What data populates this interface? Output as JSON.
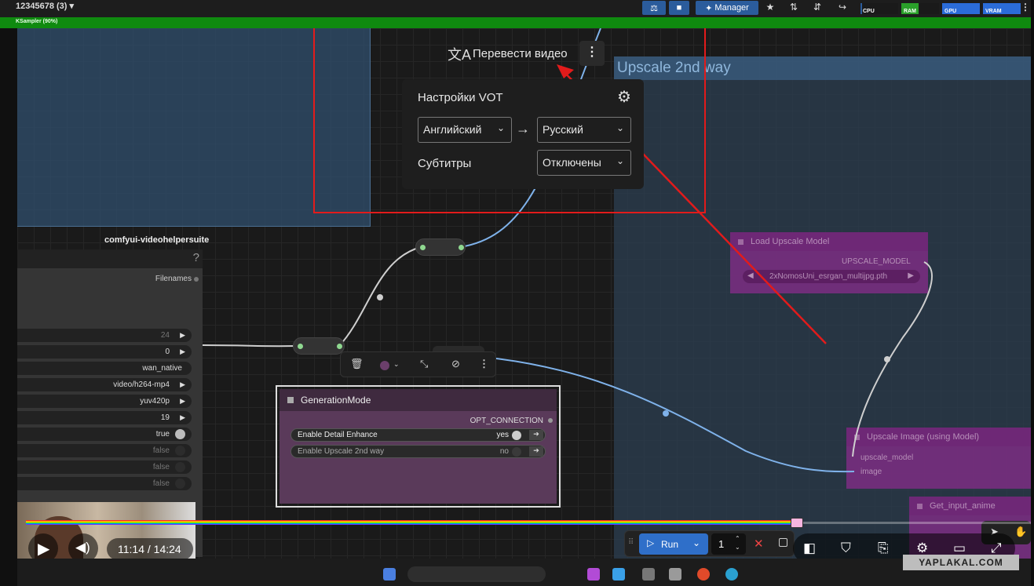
{
  "topbar": {
    "workflow_title": "12345678 (3) ▾",
    "manager_label": "Manager",
    "meters": [
      {
        "label": "CPU",
        "fill": 0.05,
        "color": "#2b5c9c"
      },
      {
        "label": "RAM",
        "fill": 0.45,
        "color": "#2aa02a"
      },
      {
        "label": "GPU",
        "fill": 1.0,
        "color": "#2b6cd9"
      },
      {
        "label": "VRAM",
        "fill": 1.0,
        "color": "#2b6cd9"
      }
    ],
    "progress_label": "KSampler (90%)"
  },
  "groups": {
    "upscale_title": "Upscale 2nd way"
  },
  "video_node": {
    "pack_label": "comfyui-videohelpersuite",
    "help": "?",
    "output": "Filenames",
    "widgets": [
      {
        "value": "24",
        "kind": "number",
        "on": false,
        "dim": true
      },
      {
        "value": "0",
        "kind": "number",
        "on": false,
        "dim": false
      },
      {
        "value": "wan_native",
        "kind": "text",
        "on": false,
        "dim": false
      },
      {
        "value": "video/h264-mp4",
        "kind": "combo",
        "on": false,
        "dim": false
      },
      {
        "value": "yuv420p",
        "kind": "combo",
        "on": false,
        "dim": false
      },
      {
        "value": "19",
        "kind": "number",
        "on": false,
        "dim": false
      },
      {
        "value": "true",
        "kind": "toggle",
        "on": true,
        "dim": false
      },
      {
        "value": "false",
        "kind": "toggle",
        "on": false,
        "dim": true
      },
      {
        "value": "false",
        "kind": "toggle",
        "on": false,
        "dim": true
      },
      {
        "value": "false",
        "kind": "toggle",
        "on": false,
        "dim": true
      }
    ]
  },
  "toolbox": {
    "delete_icon": "trash-icon",
    "color_icon": "color-picker-icon",
    "collapse_icon": "collapse-icon",
    "bypass_icon": "bypass-icon",
    "more_icon": "more-vertical-icon"
  },
  "generation_node": {
    "title": "GenerationMode",
    "output": "OPT_CONNECTION",
    "widgets": [
      {
        "label": "Enable Detail Enhance",
        "value": "yes",
        "on": true
      },
      {
        "label": "Enable Upscale 2nd way",
        "value": "no",
        "on": false
      }
    ]
  },
  "faded_nodes": {
    "load_upscale": {
      "title": "Load Upscale Model",
      "output": "UPSCALE_MODEL",
      "value": "2xNomosUni_esrgan_multijpg.pth"
    },
    "upscale_image": {
      "title": "Upscale Image (using Model)",
      "inputs": [
        "upscale_model",
        "image"
      ]
    },
    "get_input": {
      "title": "Get_input_anime"
    }
  },
  "vot": {
    "title": "Перевести видео",
    "settings_title": "Настройки VOT",
    "from_lang": "Английский",
    "to_lang": "Русский",
    "subtitles_label": "Субтитры",
    "subtitles_value": "Отключены"
  },
  "player": {
    "time": "11:14 / 14:24",
    "played_fraction": 0.766
  },
  "runbar": {
    "run_label": "Run",
    "batch_count": "1"
  },
  "watermark": "YAPLAKAL.COM"
}
